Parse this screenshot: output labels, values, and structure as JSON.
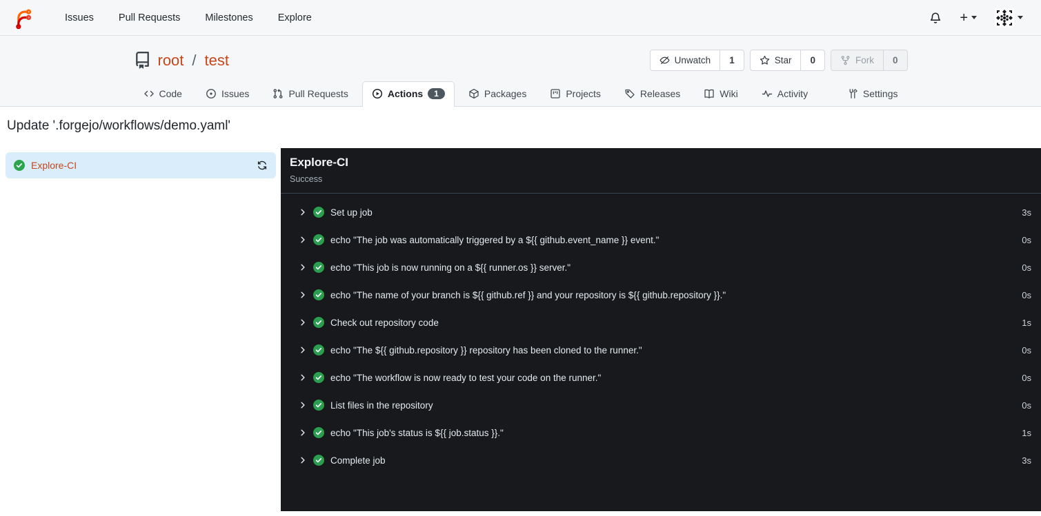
{
  "navbar": {
    "links": [
      "Issues",
      "Pull Requests",
      "Milestones",
      "Explore"
    ],
    "plus_label": "+"
  },
  "repo": {
    "owner": "root",
    "separator": "/",
    "name": "test",
    "buttons": {
      "unwatch": {
        "label": "Unwatch",
        "count": "1"
      },
      "star": {
        "label": "Star",
        "count": "0"
      },
      "fork": {
        "label": "Fork",
        "count": "0"
      }
    },
    "tabs": [
      {
        "label": "Code"
      },
      {
        "label": "Issues"
      },
      {
        "label": "Pull Requests"
      },
      {
        "label": "Actions",
        "badge": "1"
      },
      {
        "label": "Packages"
      },
      {
        "label": "Projects"
      },
      {
        "label": "Releases"
      },
      {
        "label": "Wiki"
      },
      {
        "label": "Activity"
      },
      {
        "label": "Settings"
      }
    ]
  },
  "page": {
    "title": "Update '.forgejo/workflows/demo.yaml'"
  },
  "sidebar": {
    "job": {
      "name": "Explore-CI",
      "status": "success"
    }
  },
  "panel": {
    "title": "Explore-CI",
    "status": "Success",
    "steps": [
      {
        "label": "Set up job",
        "duration": "3s"
      },
      {
        "label": "echo \"The job was automatically triggered by a ${{ github.event_name }} event.\"",
        "duration": "0s"
      },
      {
        "label": "echo \"This job is now running on a ${{ runner.os }} server.\"",
        "duration": "0s"
      },
      {
        "label": "echo \"The name of your branch is ${{ github.ref }} and your repository is ${{ github.repository }}.\"",
        "duration": "0s"
      },
      {
        "label": "Check out repository code",
        "duration": "1s"
      },
      {
        "label": "echo \"The ${{ github.repository }} repository has been cloned to the runner.\"",
        "duration": "0s"
      },
      {
        "label": "echo \"The workflow is now ready to test your code on the runner.\"",
        "duration": "0s"
      },
      {
        "label": "List files in the repository",
        "duration": "0s"
      },
      {
        "label": "echo \"This job's status is ${{ job.status }}.\"",
        "duration": "1s"
      },
      {
        "label": "Complete job",
        "duration": "3s"
      }
    ]
  },
  "colors": {
    "accent_link": "#c7461c",
    "success_green": "#2da44e",
    "panel_bg": "#17191c",
    "selected_job_bg": "#d9edfa",
    "badge_bg": "#4c5760",
    "logo_orange": "#ff6600",
    "logo_red": "#d40000"
  }
}
